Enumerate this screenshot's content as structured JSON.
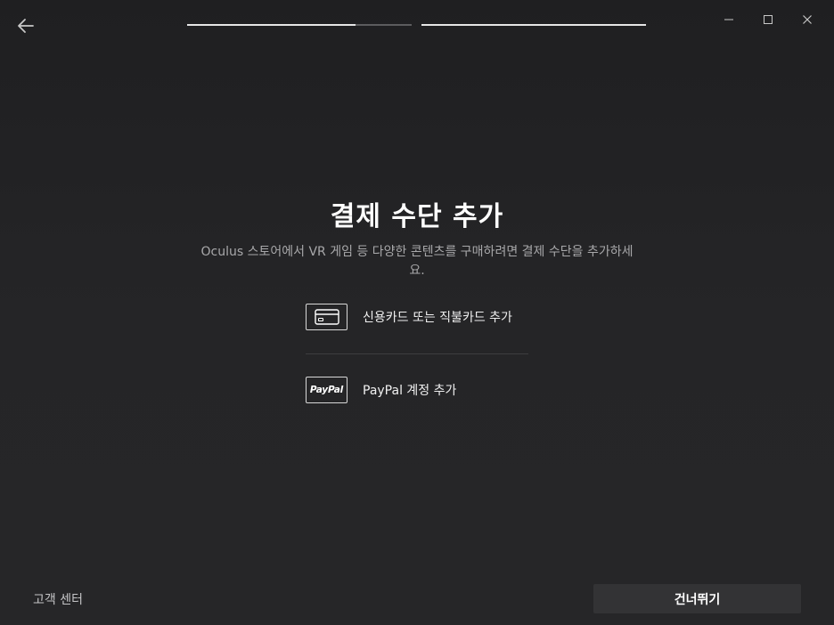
{
  "header": {
    "back_icon": "arrow-left-icon",
    "progress": [
      {
        "fill_fraction": 0.75
      },
      {
        "fill_fraction": 1.0
      }
    ],
    "window_controls": [
      "minimize-icon",
      "maximize-icon",
      "close-icon"
    ]
  },
  "main": {
    "title": "결제 수단 추가",
    "subtitle": "Oculus 스토어에서 VR 게임 등 다양한 콘텐츠를 구매하려면 결제 수단을 추가하세요.",
    "options": [
      {
        "icon": "credit-card-icon",
        "label": "신용카드 또는 직불카드 추가"
      },
      {
        "icon": "paypal-logo-icon",
        "icon_text": "PayPal",
        "label": "PayPal 계정 추가"
      }
    ]
  },
  "footer": {
    "help_link": "고객 센터",
    "skip_button": "건너뛰기"
  },
  "colors": {
    "background": "#242426",
    "progress_active": "#e6e6e6",
    "progress_track": "#5c5c5e",
    "button_bg": "#333335",
    "subtitle_text": "#a8a8aa"
  }
}
